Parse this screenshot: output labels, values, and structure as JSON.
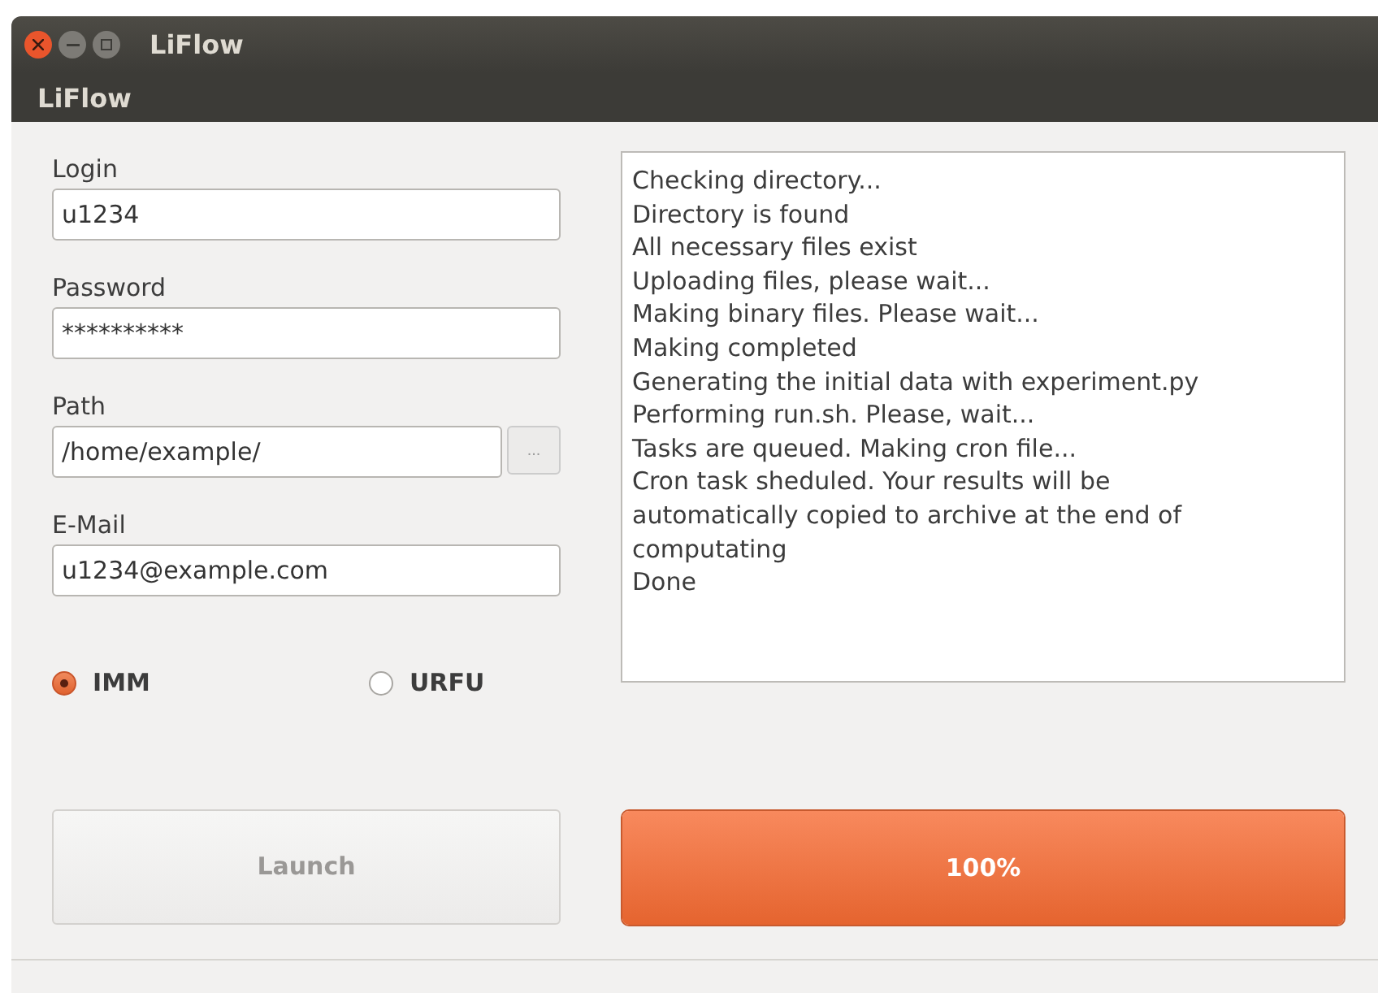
{
  "window": {
    "title": "LiFlow"
  },
  "menu_bar": {
    "title": "LiFlow"
  },
  "form": {
    "fields": [
      {
        "label": "Login",
        "value": "u1234"
      },
      {
        "label": "Password",
        "value": "**********"
      },
      {
        "label": "Path",
        "value": "/home/example/",
        "browse": "..."
      },
      {
        "label": "E-Mail",
        "value": "u1234@example.com"
      }
    ],
    "radios": [
      {
        "label": "IMM",
        "selected": true
      },
      {
        "label": "URFU",
        "selected": false
      }
    ]
  },
  "log": [
    "Checking directory...",
    "Directory is found",
    "All necessary files exist",
    "Uploading files, please wait...",
    "Making binary files. Please wait...",
    "Making completed",
    "Generating the initial data with experiment.py",
    "Performing run.sh. Please, wait...",
    "Tasks are queued. Making cron file...",
    "Cron task sheduled. Your results will be",
    "automatically copied to archive at the end of",
    "computating",
    "Done"
  ],
  "launch": {
    "label": "Launch",
    "disabled": true
  },
  "progress": {
    "label": "100%",
    "level": 1.0
  }
}
